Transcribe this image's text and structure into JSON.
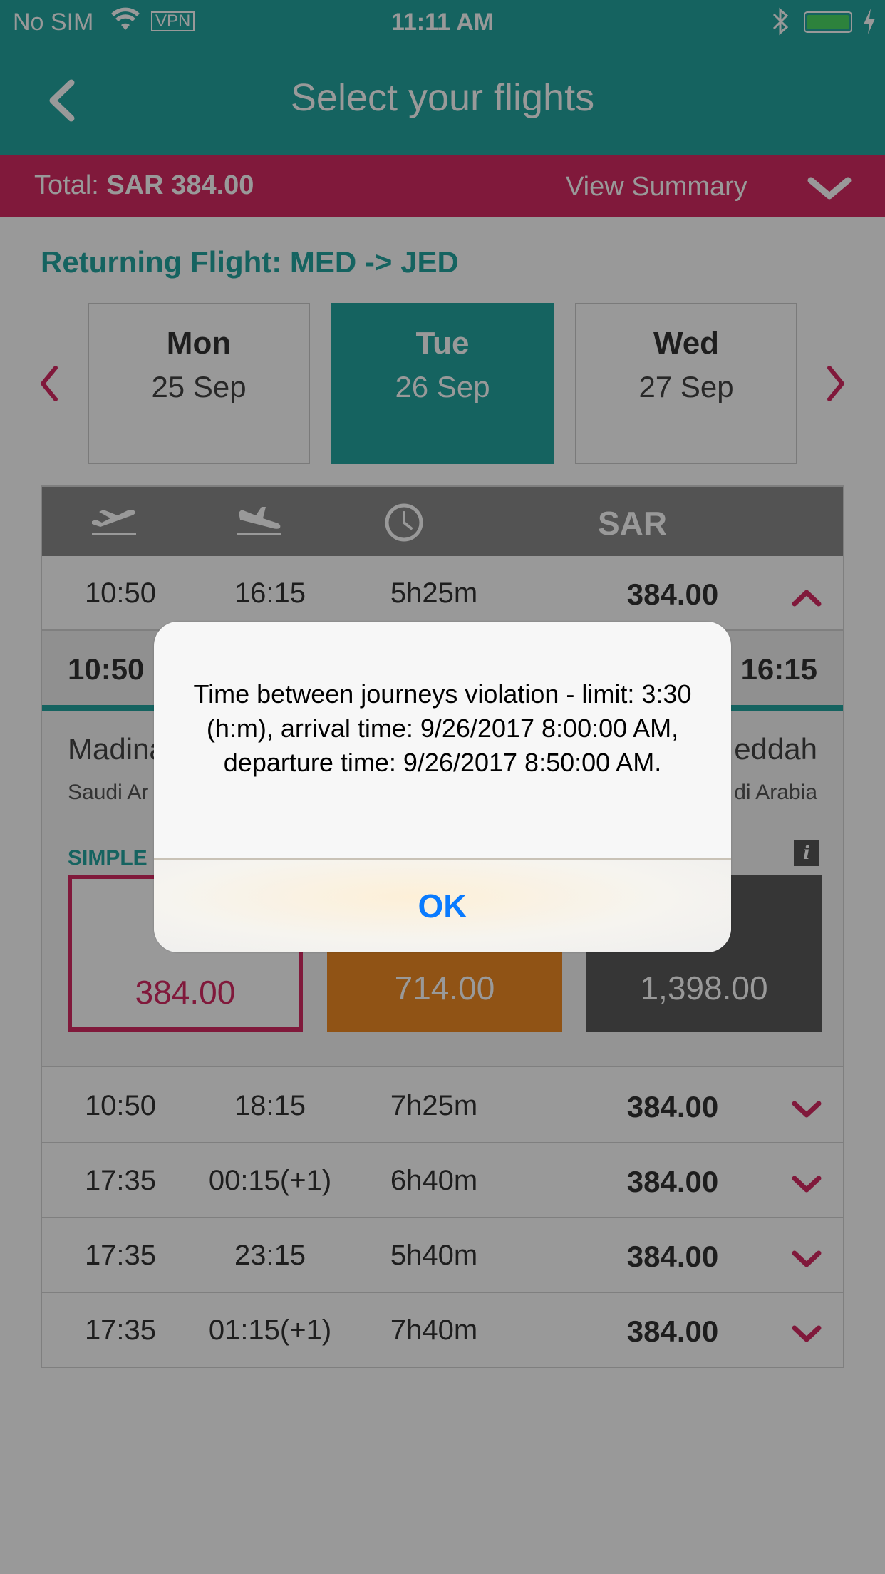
{
  "status_bar": {
    "carrier": "No SIM",
    "vpn": "VPN",
    "time": "11:11 AM"
  },
  "nav": {
    "title": "Select your flights"
  },
  "total_bar": {
    "total_label": "Total:",
    "total_value": "SAR 384.00",
    "view_summary": "View Summary"
  },
  "section_title": "Returning Flight: MED -> JED",
  "dates": [
    {
      "dow": "Mon",
      "date": "25 Sep",
      "selected": false
    },
    {
      "dow": "Tue",
      "date": "26 Sep",
      "selected": true
    },
    {
      "dow": "Wed",
      "date": "27 Sep",
      "selected": false
    }
  ],
  "table": {
    "currency": "SAR",
    "rows": [
      {
        "depart": "10:50",
        "arrive": "16:15",
        "duration": "5h25m",
        "price": "384.00",
        "expanded": true
      },
      {
        "depart": "10:50",
        "arrive": "18:15",
        "duration": "7h25m",
        "price": "384.00",
        "expanded": false
      },
      {
        "depart": "17:35",
        "arrive": "00:15(+1)",
        "duration": "6h40m",
        "price": "384.00",
        "expanded": false
      },
      {
        "depart": "17:35",
        "arrive": "23:15",
        "duration": "5h40m",
        "price": "384.00",
        "expanded": false
      },
      {
        "depart": "17:35",
        "arrive": "01:15(+1)",
        "duration": "7h40m",
        "price": "384.00",
        "expanded": false
      }
    ],
    "detail": {
      "depart_time": "10:50",
      "arrive_time": "16:15",
      "origin_city": "Madina",
      "origin_country": "Saudi Ar",
      "dest_city": "eddah",
      "dest_country": "di Arabia",
      "fare_label": "SIMPLE",
      "fares": [
        "384.00",
        "714.00",
        "1,398.00"
      ]
    }
  },
  "alert": {
    "message": "Time between journeys violation - limit: 3:30 (h:m), arrival time: 9/26/2017 8:00:00 AM, departure time: 9/26/2017 8:50:00 AM.",
    "ok_label": "OK"
  },
  "colors": {
    "teal": "#23a6a0",
    "magenta": "#d62a63",
    "orange": "#f08a24",
    "dark_fare": "#5a5a5a",
    "alert_button": "#0a7bff"
  }
}
